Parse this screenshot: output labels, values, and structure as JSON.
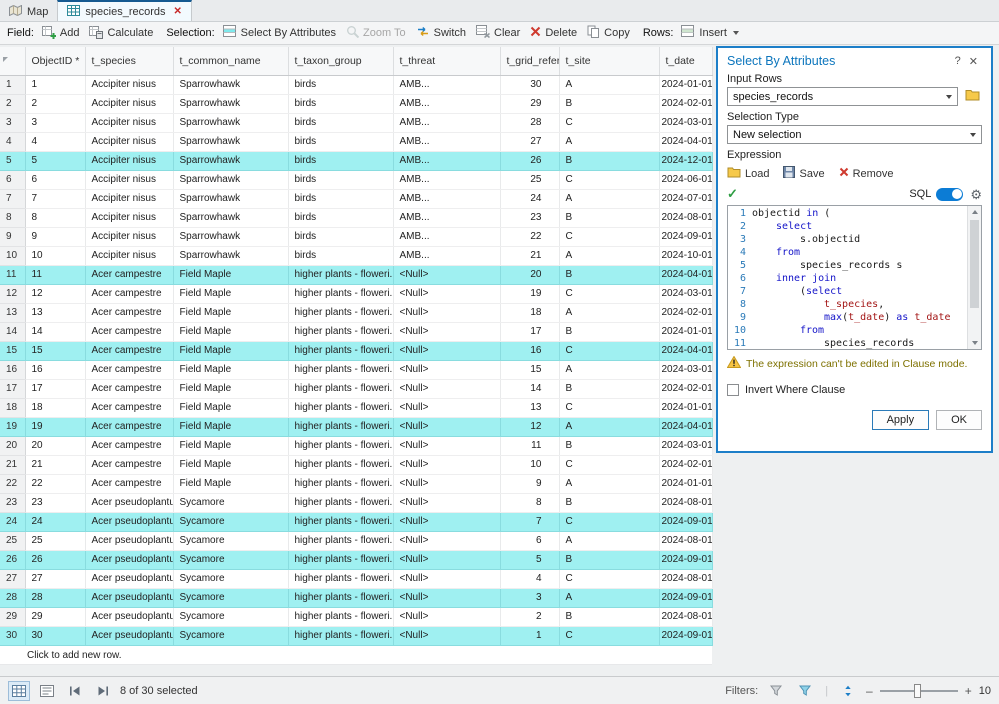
{
  "icons": {
    "help": "?",
    "close": "✕",
    "tab_close": "✕",
    "gear": "⚙",
    "check": "✓"
  },
  "colors": {
    "selection_cyan": "#9ff0f1",
    "accent_blue": "#0d76bd",
    "panel_border": "#1c7ec8",
    "sql_keyword": "#1414c8",
    "sql_field": "#a31515",
    "warning_text": "#7e7100",
    "tab_close_red": "#c62828"
  },
  "tabs": {
    "map": "Map",
    "species_records": "species_records"
  },
  "toolbar": {
    "field_label": "Field:",
    "add": "Add",
    "calculate": "Calculate",
    "selection_label": "Selection:",
    "select_by_attributes": "Select By Attributes",
    "zoom_to": "Zoom To",
    "switch": "Switch",
    "clear": "Clear",
    "delete": "Delete",
    "copy": "Copy",
    "rows_label": "Rows:",
    "insert": "Insert"
  },
  "table": {
    "columns": [
      "",
      "ObjectID *",
      "t_species",
      "t_common_name",
      "t_taxon_group",
      "t_threat",
      "t_grid_refer",
      "t_site",
      "t_date"
    ],
    "add_row_text": "Click to add new row.",
    "rows": [
      {
        "n": 1,
        "id": 1,
        "sp": "Accipiter nisus",
        "cn": "Sparrowhawk",
        "tx": "birds",
        "th": "AMB...",
        "gr": 30,
        "st": "A",
        "dt": "2024-01-01",
        "sel": false
      },
      {
        "n": 2,
        "id": 2,
        "sp": "Accipiter nisus",
        "cn": "Sparrowhawk",
        "tx": "birds",
        "th": "AMB...",
        "gr": 29,
        "st": "B",
        "dt": "2024-02-01",
        "sel": false
      },
      {
        "n": 3,
        "id": 3,
        "sp": "Accipiter nisus",
        "cn": "Sparrowhawk",
        "tx": "birds",
        "th": "AMB...",
        "gr": 28,
        "st": "C",
        "dt": "2024-03-01",
        "sel": false
      },
      {
        "n": 4,
        "id": 4,
        "sp": "Accipiter nisus",
        "cn": "Sparrowhawk",
        "tx": "birds",
        "th": "AMB...",
        "gr": 27,
        "st": "A",
        "dt": "2024-04-01",
        "sel": false
      },
      {
        "n": 5,
        "id": 5,
        "sp": "Accipiter nisus",
        "cn": "Sparrowhawk",
        "tx": "birds",
        "th": "AMB...",
        "gr": 26,
        "st": "B",
        "dt": "2024-12-01",
        "sel": true
      },
      {
        "n": 6,
        "id": 6,
        "sp": "Accipiter nisus",
        "cn": "Sparrowhawk",
        "tx": "birds",
        "th": "AMB...",
        "gr": 25,
        "st": "C",
        "dt": "2024-06-01",
        "sel": false
      },
      {
        "n": 7,
        "id": 7,
        "sp": "Accipiter nisus",
        "cn": "Sparrowhawk",
        "tx": "birds",
        "th": "AMB...",
        "gr": 24,
        "st": "A",
        "dt": "2024-07-01",
        "sel": false
      },
      {
        "n": 8,
        "id": 8,
        "sp": "Accipiter nisus",
        "cn": "Sparrowhawk",
        "tx": "birds",
        "th": "AMB...",
        "gr": 23,
        "st": "B",
        "dt": "2024-08-01",
        "sel": false
      },
      {
        "n": 9,
        "id": 9,
        "sp": "Accipiter nisus",
        "cn": "Sparrowhawk",
        "tx": "birds",
        "th": "AMB...",
        "gr": 22,
        "st": "C",
        "dt": "2024-09-01",
        "sel": false
      },
      {
        "n": 10,
        "id": 10,
        "sp": "Accipiter nisus",
        "cn": "Sparrowhawk",
        "tx": "birds",
        "th": "AMB...",
        "gr": 21,
        "st": "A",
        "dt": "2024-10-01",
        "sel": false
      },
      {
        "n": 11,
        "id": 11,
        "sp": "Acer campestre",
        "cn": "Field Maple",
        "tx": "higher plants - floweri...",
        "th": "<Null>",
        "gr": 20,
        "st": "B",
        "dt": "2024-04-01",
        "sel": true
      },
      {
        "n": 12,
        "id": 12,
        "sp": "Acer campestre",
        "cn": "Field Maple",
        "tx": "higher plants - floweri...",
        "th": "<Null>",
        "gr": 19,
        "st": "C",
        "dt": "2024-03-01",
        "sel": false
      },
      {
        "n": 13,
        "id": 13,
        "sp": "Acer campestre",
        "cn": "Field Maple",
        "tx": "higher plants - floweri...",
        "th": "<Null>",
        "gr": 18,
        "st": "A",
        "dt": "2024-02-01",
        "sel": false
      },
      {
        "n": 14,
        "id": 14,
        "sp": "Acer campestre",
        "cn": "Field Maple",
        "tx": "higher plants - floweri...",
        "th": "<Null>",
        "gr": 17,
        "st": "B",
        "dt": "2024-01-01",
        "sel": false
      },
      {
        "n": 15,
        "id": 15,
        "sp": "Acer campestre",
        "cn": "Field Maple",
        "tx": "higher plants - floweri...",
        "th": "<Null>",
        "gr": 16,
        "st": "C",
        "dt": "2024-04-01",
        "sel": true
      },
      {
        "n": 16,
        "id": 16,
        "sp": "Acer campestre",
        "cn": "Field Maple",
        "tx": "higher plants - floweri...",
        "th": "<Null>",
        "gr": 15,
        "st": "A",
        "dt": "2024-03-01",
        "sel": false
      },
      {
        "n": 17,
        "id": 17,
        "sp": "Acer campestre",
        "cn": "Field Maple",
        "tx": "higher plants - floweri...",
        "th": "<Null>",
        "gr": 14,
        "st": "B",
        "dt": "2024-02-01",
        "sel": false
      },
      {
        "n": 18,
        "id": 18,
        "sp": "Acer campestre",
        "cn": "Field Maple",
        "tx": "higher plants - floweri...",
        "th": "<Null>",
        "gr": 13,
        "st": "C",
        "dt": "2024-01-01",
        "sel": false
      },
      {
        "n": 19,
        "id": 19,
        "sp": "Acer campestre",
        "cn": "Field Maple",
        "tx": "higher plants - floweri...",
        "th": "<Null>",
        "gr": 12,
        "st": "A",
        "dt": "2024-04-01",
        "sel": true
      },
      {
        "n": 20,
        "id": 20,
        "sp": "Acer campestre",
        "cn": "Field Maple",
        "tx": "higher plants - floweri...",
        "th": "<Null>",
        "gr": 11,
        "st": "B",
        "dt": "2024-03-01",
        "sel": false
      },
      {
        "n": 21,
        "id": 21,
        "sp": "Acer campestre",
        "cn": "Field Maple",
        "tx": "higher plants - floweri...",
        "th": "<Null>",
        "gr": 10,
        "st": "C",
        "dt": "2024-02-01",
        "sel": false
      },
      {
        "n": 22,
        "id": 22,
        "sp": "Acer campestre",
        "cn": "Field Maple",
        "tx": "higher plants - floweri...",
        "th": "<Null>",
        "gr": 9,
        "st": "A",
        "dt": "2024-01-01",
        "sel": false
      },
      {
        "n": 23,
        "id": 23,
        "sp": "Acer pseudoplantus",
        "cn": "Sycamore",
        "tx": "higher plants - floweri...",
        "th": "<Null>",
        "gr": 8,
        "st": "B",
        "dt": "2024-08-01",
        "sel": false
      },
      {
        "n": 24,
        "id": 24,
        "sp": "Acer pseudoplantus",
        "cn": "Sycamore",
        "tx": "higher plants - floweri...",
        "th": "<Null>",
        "gr": 7,
        "st": "C",
        "dt": "2024-09-01",
        "sel": true
      },
      {
        "n": 25,
        "id": 25,
        "sp": "Acer pseudoplantus",
        "cn": "Sycamore",
        "tx": "higher plants - floweri...",
        "th": "<Null>",
        "gr": 6,
        "st": "A",
        "dt": "2024-08-01",
        "sel": false
      },
      {
        "n": 26,
        "id": 26,
        "sp": "Acer pseudoplantus",
        "cn": "Sycamore",
        "tx": "higher plants - floweri...",
        "th": "<Null>",
        "gr": 5,
        "st": "B",
        "dt": "2024-09-01",
        "sel": true
      },
      {
        "n": 27,
        "id": 27,
        "sp": "Acer pseudoplantus",
        "cn": "Sycamore",
        "tx": "higher plants - floweri...",
        "th": "<Null>",
        "gr": 4,
        "st": "C",
        "dt": "2024-08-01",
        "sel": false
      },
      {
        "n": 28,
        "id": 28,
        "sp": "Acer pseudoplantus",
        "cn": "Sycamore",
        "tx": "higher plants - floweri...",
        "th": "<Null>",
        "gr": 3,
        "st": "A",
        "dt": "2024-09-01",
        "sel": true
      },
      {
        "n": 29,
        "id": 29,
        "sp": "Acer pseudoplantus",
        "cn": "Sycamore",
        "tx": "higher plants - floweri...",
        "th": "<Null>",
        "gr": 2,
        "st": "B",
        "dt": "2024-08-01",
        "sel": false
      },
      {
        "n": 30,
        "id": 30,
        "sp": "Acer pseudoplantus",
        "cn": "Sycamore",
        "tx": "higher plants - floweri...",
        "th": "<Null>",
        "gr": 1,
        "st": "C",
        "dt": "2024-09-01",
        "sel": true
      }
    ]
  },
  "panel": {
    "title": "Select By Attributes",
    "input_rows_label": "Input Rows",
    "input_rows_value": "species_records",
    "selection_type_label": "Selection Type",
    "selection_type_value": "New selection",
    "expression_label": "Expression",
    "load_label": "Load",
    "save_label": "Save",
    "remove_label": "Remove",
    "sql_label": "SQL",
    "warning_text": "The expression can't be edited in Clause mode.",
    "invert_where_clause_label": "Invert Where Clause",
    "apply_label": "Apply",
    "ok_label": "OK",
    "code_lines": [
      {
        "num": 1,
        "indent": 0,
        "tokens": [
          {
            "t": "objectid ",
            "c": "id"
          },
          {
            "t": "in",
            "c": "kw"
          },
          {
            "t": " (",
            "c": "id"
          }
        ]
      },
      {
        "num": 2,
        "indent": 4,
        "tokens": [
          {
            "t": "select",
            "c": "kw"
          }
        ]
      },
      {
        "num": 3,
        "indent": 8,
        "tokens": [
          {
            "t": "s.objectid",
            "c": "id"
          }
        ]
      },
      {
        "num": 4,
        "indent": 4,
        "tokens": [
          {
            "t": "from",
            "c": "kw"
          }
        ]
      },
      {
        "num": 5,
        "indent": 8,
        "tokens": [
          {
            "t": "species_records s",
            "c": "id"
          }
        ]
      },
      {
        "num": 6,
        "indent": 4,
        "tokens": [
          {
            "t": "inner join",
            "c": "kw"
          }
        ]
      },
      {
        "num": 7,
        "indent": 8,
        "tokens": [
          {
            "t": "(",
            "c": "id"
          },
          {
            "t": "select",
            "c": "kw"
          }
        ]
      },
      {
        "num": 8,
        "indent": 12,
        "tokens": [
          {
            "t": "t_species",
            "c": "fld"
          },
          {
            "t": ",",
            "c": "id"
          }
        ]
      },
      {
        "num": 9,
        "indent": 12,
        "tokens": [
          {
            "t": "max",
            "c": "kw"
          },
          {
            "t": "(",
            "c": "id"
          },
          {
            "t": "t_date",
            "c": "fld"
          },
          {
            "t": ") ",
            "c": "id"
          },
          {
            "t": "as",
            "c": "kw"
          },
          {
            "t": " ",
            "c": "id"
          },
          {
            "t": "t_date",
            "c": "fld"
          }
        ]
      },
      {
        "num": 10,
        "indent": 8,
        "tokens": [
          {
            "t": "from",
            "c": "kw"
          }
        ]
      },
      {
        "num": 11,
        "indent": 12,
        "tokens": [
          {
            "t": "species_records",
            "c": "id"
          }
        ]
      }
    ]
  },
  "statusbar": {
    "selected_text": "8 of 30 selected",
    "filters_label": "Filters:",
    "zoom_out": "–",
    "zoom_in": "+",
    "zoom_text": "10"
  }
}
